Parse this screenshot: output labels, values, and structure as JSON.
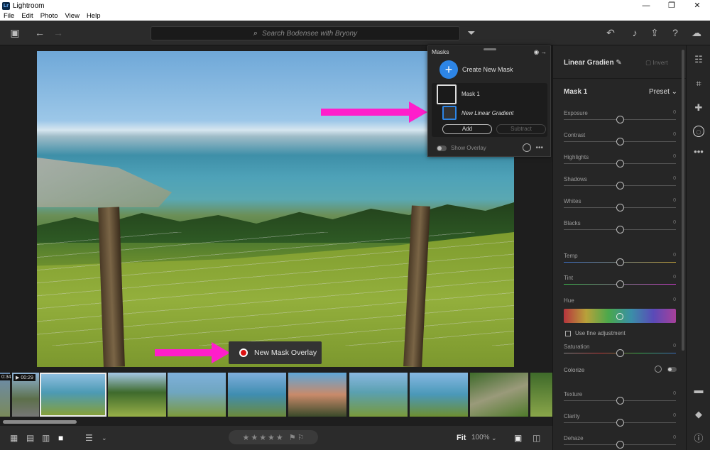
{
  "window": {
    "title": "Lightroom",
    "app_icon_text": "Lr",
    "controls": [
      "—",
      "❐",
      "✕"
    ]
  },
  "menu": [
    "File",
    "Edit",
    "Photo",
    "View",
    "Help"
  ],
  "toolbar": {
    "search_placeholder": "Search Bodensee with Bryony"
  },
  "masks_panel": {
    "title": "Masks",
    "create_label": "Create New Mask",
    "mask1_label": "Mask 1",
    "gradient_label": "New Linear Gradient",
    "add_label": "Add",
    "subtract_label": "Subtract",
    "show_overlay_label": "Show Overlay"
  },
  "overlay_button": {
    "label": "New Mask Overlay"
  },
  "filmstrip": {
    "durations": [
      "0:34",
      "▶ 00:29"
    ]
  },
  "bottom": {
    "fit_label": "Fit",
    "zoom_label": "100%",
    "rating": "★★★★★"
  },
  "edit_panel": {
    "gradient_title": "Linear Gradien",
    "invert_label": "Invert",
    "mask_title": "Mask 1",
    "preset_label": "Preset",
    "sliders": [
      {
        "label": "Exposure",
        "value": "0"
      },
      {
        "label": "Contrast",
        "value": "0"
      },
      {
        "label": "Highlights",
        "value": "0"
      },
      {
        "label": "Shadows",
        "value": "0"
      },
      {
        "label": "Whites",
        "value": "0"
      },
      {
        "label": "Blacks",
        "value": "0"
      },
      {
        "label": "Temp",
        "value": "0"
      },
      {
        "label": "Tint",
        "value": "0"
      },
      {
        "label": "Hue",
        "value": "0"
      },
      {
        "label": "Saturation",
        "value": "0"
      },
      {
        "label": "Texture",
        "value": "0"
      },
      {
        "label": "Clarity",
        "value": "0"
      },
      {
        "label": "Dehaze",
        "value": "0"
      }
    ],
    "fine_adjust_label": "Use fine adjustment",
    "colorize_label": "Colorize"
  }
}
